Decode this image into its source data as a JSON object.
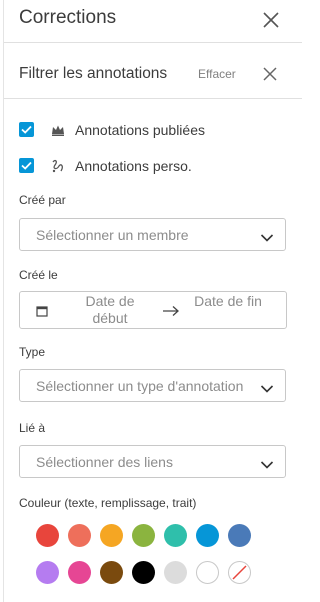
{
  "header": {
    "title": "Corrections",
    "close_icon": "close-icon"
  },
  "filter": {
    "title": "Filtrer les annotations",
    "clear_label": "Effacer",
    "close_icon": "close-icon"
  },
  "options": [
    {
      "label": "Annotations publiées",
      "checked": true,
      "icon": "crown-icon"
    },
    {
      "label": "Annotations perso.",
      "checked": true,
      "icon": "markup-icon"
    }
  ],
  "created_by": {
    "label": "Créé par",
    "placeholder": "Sélectionner un membre"
  },
  "created_on": {
    "label": "Créé le",
    "start_placeholder": "Date de début",
    "end_placeholder": "Date de fin"
  },
  "type": {
    "label": "Type",
    "placeholder": "Sélectionner un type d'annotation"
  },
  "linked_to": {
    "label": "Lié à",
    "placeholder": "Sélectionner des liens"
  },
  "color": {
    "label": "Couleur (texte, remplissage, trait)",
    "swatches": [
      "#e8453c",
      "#ee6f5b",
      "#f5a623",
      "#8bb43f",
      "#2fbfab",
      "#0696d7",
      "#4a7ab8",
      "#b57cf0",
      "#e64694",
      "#7a4a0e",
      "#000000",
      "#dcdcdc",
      "#ffffff",
      "none"
    ]
  }
}
